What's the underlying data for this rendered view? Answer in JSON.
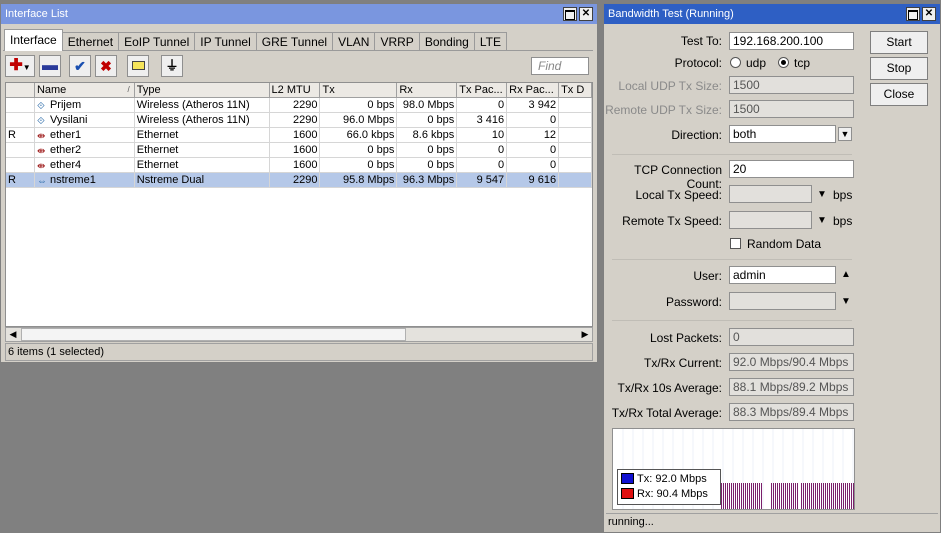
{
  "interface_window": {
    "title": "Interface List",
    "tabs": [
      "Interface",
      "Ethernet",
      "EoIP Tunnel",
      "IP Tunnel",
      "GRE Tunnel",
      "VLAN",
      "VRRP",
      "Bonding",
      "LTE"
    ],
    "active_tab": "Interface",
    "find_placeholder": "Find",
    "columns": [
      "",
      "Name",
      "Type",
      "L2 MTU",
      "Tx",
      "Rx",
      "Tx Pac...",
      "Rx Pac...",
      "Tx D"
    ],
    "rows": [
      {
        "flag": "",
        "name": "Prijem",
        "type": "Wireless (Atheros 11N)",
        "l2mtu": "2290",
        "tx": "0 bps",
        "rx": "98.0 Mbps",
        "txp": "0",
        "rxp": "3 942",
        "icon": "wireless-icon",
        "selected": false
      },
      {
        "flag": "",
        "name": "Vysilani",
        "type": "Wireless (Atheros 11N)",
        "l2mtu": "2290",
        "tx": "96.0 Mbps",
        "rx": "0 bps",
        "txp": "3 416",
        "rxp": "0",
        "icon": "wireless-icon",
        "selected": false
      },
      {
        "flag": "R",
        "name": "ether1",
        "type": "Ethernet",
        "l2mtu": "1600",
        "tx": "66.0 kbps",
        "rx": "8.6 kbps",
        "txp": "10",
        "rxp": "12",
        "icon": "ethernet-icon",
        "selected": false
      },
      {
        "flag": "",
        "name": "ether2",
        "type": "Ethernet",
        "l2mtu": "1600",
        "tx": "0 bps",
        "rx": "0 bps",
        "txp": "0",
        "rxp": "0",
        "icon": "ethernet-icon",
        "selected": false
      },
      {
        "flag": "",
        "name": "ether4",
        "type": "Ethernet",
        "l2mtu": "1600",
        "tx": "0 bps",
        "rx": "0 bps",
        "txp": "0",
        "rxp": "0",
        "icon": "ethernet-icon",
        "selected": false
      },
      {
        "flag": "R",
        "name": "nstreme1",
        "type": "Nstreme Dual",
        "l2mtu": "2290",
        "tx": "95.8 Mbps",
        "rx": "96.3 Mbps",
        "txp": "9 547",
        "rxp": "9 616",
        "icon": "nstreme-icon",
        "selected": true
      }
    ],
    "status": "6 items (1 selected)"
  },
  "bandwidth_window": {
    "title": "Bandwidth Test (Running)",
    "buttons": {
      "start": "Start",
      "stop": "Stop",
      "close": "Close"
    },
    "labels": {
      "test_to": "Test To:",
      "protocol": "Protocol:",
      "local_udp": "Local UDP Tx Size:",
      "remote_udp": "Remote UDP Tx Size:",
      "direction": "Direction:",
      "tcp_count": "TCP Connection Count:",
      "local_speed": "Local Tx Speed:",
      "remote_speed": "Remote Tx Speed:",
      "random_data": "Random Data",
      "user": "User:",
      "password": "Password:",
      "lost": "Lost Packets:",
      "current": "Tx/Rx Current:",
      "avg10": "Tx/Rx 10s Average:",
      "total": "Tx/Rx Total Average:",
      "bps": "bps"
    },
    "values": {
      "test_to": "192.168.200.100",
      "protocol_udp": "udp",
      "protocol_tcp": "tcp",
      "protocol_selected": "tcp",
      "local_udp": "1500",
      "remote_udp": "1500",
      "direction": "both",
      "tcp_count": "20",
      "local_speed": "",
      "remote_speed": "",
      "random_data": false,
      "user": "admin",
      "password": "",
      "lost": "0",
      "current": "92.0 Mbps/90.4 Mbps",
      "avg10": "88.1 Mbps/89.2 Mbps",
      "total": "88.3 Mbps/89.4 Mbps"
    },
    "legend": {
      "tx": "Tx:  92.0 Mbps",
      "rx": "Rx:  90.4 Mbps"
    },
    "colors": {
      "tx": "#1010d0",
      "rx": "#e01010",
      "bars": "#7a1f6a"
    },
    "status": "running..."
  }
}
